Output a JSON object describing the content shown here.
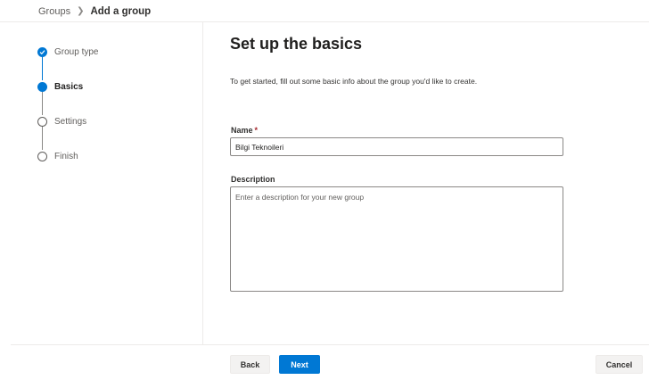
{
  "breadcrumb": {
    "root": "Groups",
    "current": "Add a group"
  },
  "steps": [
    {
      "label": "Group type",
      "state": "done"
    },
    {
      "label": "Basics",
      "state": "current"
    },
    {
      "label": "Settings",
      "state": "todo"
    },
    {
      "label": "Finish",
      "state": "todo"
    }
  ],
  "main": {
    "heading": "Set up the basics",
    "intro": "To get started, fill out some basic info about the group you'd like to create.",
    "name_label": "Name",
    "required_mark": "*",
    "name_value": "Bilgi Teknoileri",
    "description_label": "Description",
    "description_placeholder": "Enter a description for your new group"
  },
  "footer": {
    "back_label": "Back",
    "next_label": "Next",
    "cancel_label": "Cancel"
  },
  "colors": {
    "accent": "#0078d4",
    "required": "#a4262c"
  }
}
